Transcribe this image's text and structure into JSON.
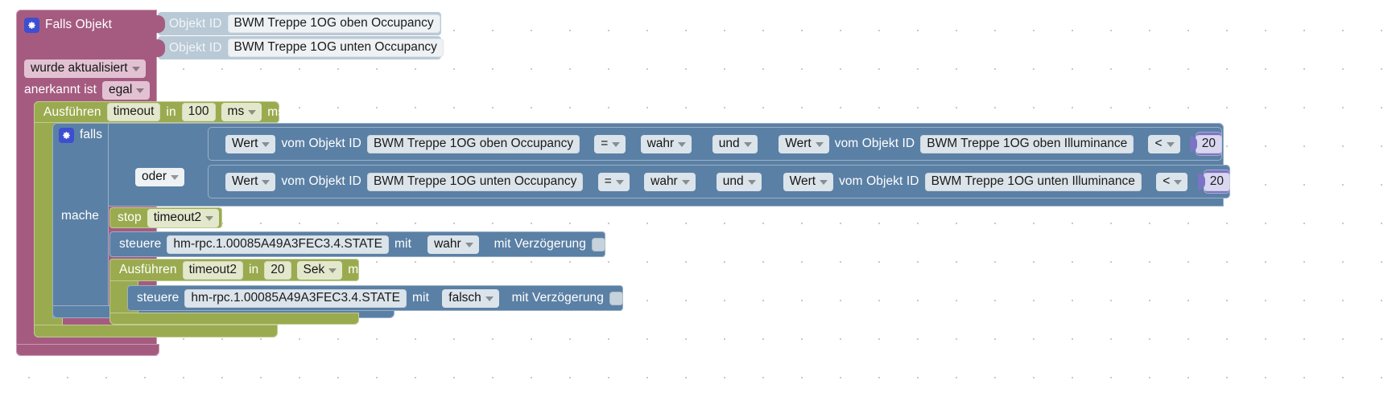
{
  "app": {
    "name": "ioBroker Blockly script editor",
    "language": "de"
  },
  "colors": {
    "trigger": "#a55b80",
    "trigger_arg": "#b9c9d6",
    "timeout": "#9aab4f",
    "logic": "#5b80a5",
    "number": "#7b74c4",
    "gear": "#3d4ed0"
  },
  "trigger_block": {
    "gear_icon": "gear-icon",
    "title": "Falls Objekt",
    "object_rows": [
      {
        "label": "Objekt ID",
        "value": "BWM Treppe 1OG oben Occupancy"
      },
      {
        "label": "Objekt ID",
        "value": "BWM Treppe 1OG unten Occupancy"
      }
    ],
    "condition_dropdown": "wurde aktualisiert",
    "ack_label": "anerkannt ist",
    "ack_dropdown": "egal"
  },
  "outer_timeout": {
    "run_label": "Ausführen",
    "name": "timeout",
    "in_label": "in",
    "delay": "100",
    "unit_dropdown": "ms",
    "unit_suffix": "ms"
  },
  "if_block": {
    "gear_icon": "gear-icon",
    "if_label": "falls",
    "do_label": "mache",
    "join_dropdown": "oder",
    "conditions": [
      {
        "left": {
          "kind_dropdown": "Wert",
          "of_label": "vom Objekt ID",
          "object_id": "BWM Treppe 1OG oben Occupancy",
          "operator": "=",
          "value_dropdown": "wahr"
        },
        "combine_dropdown": "und",
        "right": {
          "kind_dropdown": "Wert",
          "of_label": "vom Objekt ID",
          "object_id": "BWM Treppe 1OG oben Illuminance",
          "operator": "<",
          "number": "20"
        }
      },
      {
        "left": {
          "kind_dropdown": "Wert",
          "of_label": "vom Objekt ID",
          "object_id": "BWM Treppe 1OG unten Occupancy",
          "operator": "=",
          "value_dropdown": "wahr"
        },
        "combine_dropdown": "und",
        "right": {
          "kind_dropdown": "Wert",
          "of_label": "vom Objekt ID",
          "object_id": "BWM Treppe 1OG unten Illuminance",
          "operator": "<",
          "number": "20"
        }
      }
    ]
  },
  "stop_block": {
    "stop_label": "stop",
    "timer_dropdown": "timeout2"
  },
  "control_on": {
    "control_label": "steuere",
    "object_id": "hm-rpc.1.00085A49A3FEC3.4.STATE",
    "with_label": "mit",
    "value_dropdown": "wahr",
    "delay_label": "mit Verzögerung",
    "delay_checked": false
  },
  "inner_timeout": {
    "run_label": "Ausführen",
    "name": "timeout2",
    "in_label": "in",
    "delay": "20",
    "unit_dropdown": "Sek",
    "unit_suffix": "ms"
  },
  "control_off": {
    "control_label": "steuere",
    "object_id": "hm-rpc.1.00085A49A3FEC3.4.STATE",
    "with_label": "mit",
    "value_dropdown": "falsch",
    "delay_label": "mit Verzögerung",
    "delay_checked": false
  }
}
